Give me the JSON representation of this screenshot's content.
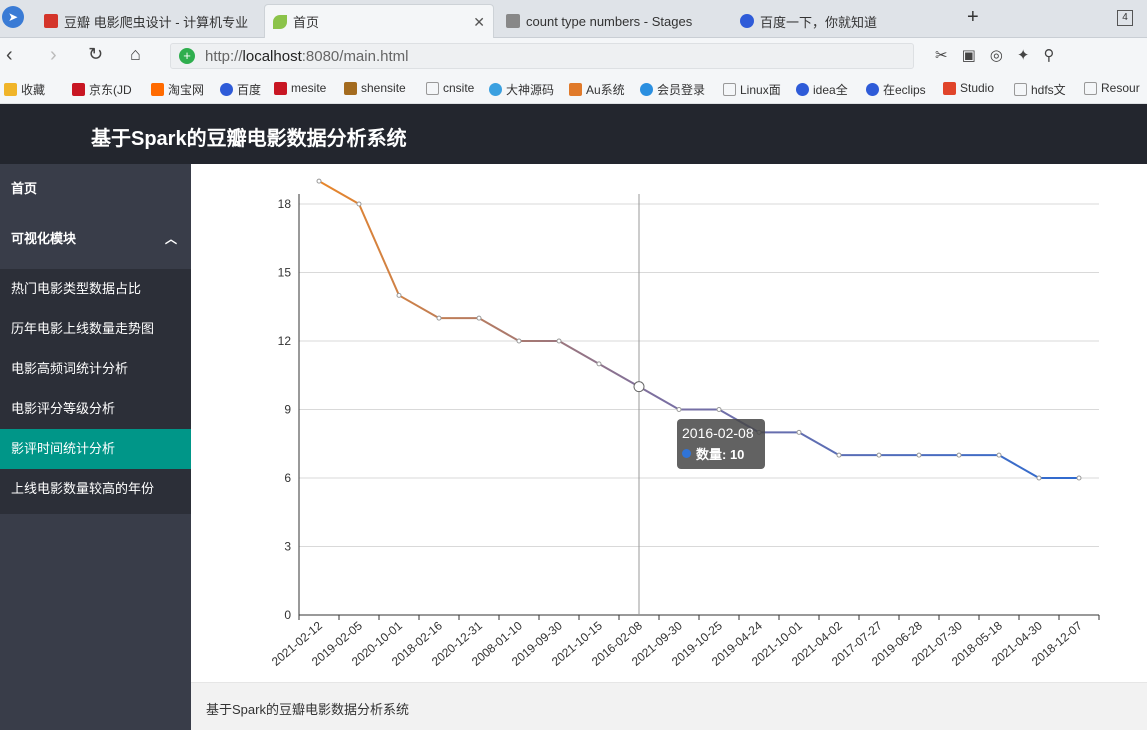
{
  "browser": {
    "tabs": [
      {
        "label": "豆瓣 电影爬虫设计 - 计算机专业",
        "color": "#d4352a"
      },
      {
        "label": "首页",
        "color": "#8bc34a"
      },
      {
        "label": "count type numbers - Stages",
        "color": "#666666"
      },
      {
        "label": "百度一下，你就知道",
        "color": "#2e5bd8"
      }
    ],
    "tab_count": "4",
    "url_prefix": "http://",
    "url_host": "localhost",
    "url_rest": ":8080/main.html",
    "bookmarks": [
      "收藏",
      "京东(JD",
      "淘宝网",
      "百度",
      "mesite",
      "shensite",
      "cnsite",
      "大神源码",
      "Au系统",
      "会员登录",
      "Linux面",
      "idea全",
      "在eclips",
      "Studio",
      "hdfs文",
      "Resour"
    ]
  },
  "app": {
    "title": "基于Spark的豆瓣电影数据分析系统",
    "footer": "基于Spark的豆瓣电影数据分析系统"
  },
  "sidebar": {
    "home": "首页",
    "group": "可视化模块",
    "items": [
      "热门电影类型数据占比",
      "历年电影上线数量走势图",
      "电影高频词统计分析",
      "电影评分等级分析",
      "影评时间统计分析",
      "上线电影数量较高的年份"
    ],
    "active_index": 4
  },
  "tooltip": {
    "date": "2016-02-08",
    "label": "数量: 10"
  },
  "chart_data": {
    "type": "line",
    "categories": [
      "2021-02-12",
      "2019-02-05",
      "2020-10-01",
      "2018-02-16",
      "2020-12-31",
      "2008-01-10",
      "2019-09-30",
      "2021-10-15",
      "2016-02-08",
      "2021-09-30",
      "2019-10-25",
      "2019-04-24",
      "2021-10-01",
      "2021-04-02",
      "2017-07-27",
      "2019-06-28",
      "2021-07-30",
      "2018-05-18",
      "2021-04-30",
      "2018-12-07"
    ],
    "series": [
      {
        "values": [
          19,
          18,
          14,
          13,
          13,
          12,
          12,
          11,
          10,
          9,
          9,
          8,
          8,
          7,
          7,
          7,
          7,
          7,
          6,
          6
        ]
      }
    ],
    "ylim": [
      0,
      18
    ],
    "yticks": [
      0,
      3,
      6,
      9,
      12,
      15,
      18
    ],
    "grid": true,
    "colors": {
      "start": "#e8862a",
      "mid": "#7b6fa1",
      "end": "#2f6bd0"
    }
  }
}
